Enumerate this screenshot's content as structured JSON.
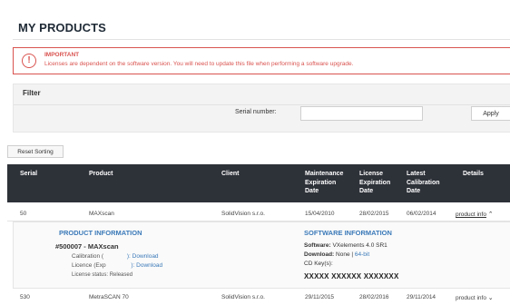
{
  "page": {
    "title": "MY PRODUCTS"
  },
  "alert": {
    "icon": "exclamation-icon",
    "title": "IMPORTANT",
    "text": "Licenses are dependent on the software version. You will need to update this file when performing a software upgrade."
  },
  "filter": {
    "title": "Filter",
    "serial_label": "Serial number:",
    "serial_value": "",
    "apply_label": "Apply"
  },
  "table": {
    "reset_label": "Reset Sorting",
    "headers": {
      "serial": "Serial",
      "product": "Product",
      "client": "Client",
      "maintenance": "Maintenance Expiration Date",
      "license": "License Expiration Date",
      "calibration": "Latest Calibration Date",
      "details": "Details"
    },
    "rows": [
      {
        "serial": "50",
        "product": "MAXscan",
        "client": "SolidVision s.r.o.",
        "maintenance": "15/04/2010",
        "license": "28/02/2015",
        "calibration": "06/02/2014",
        "details": "product info",
        "chevron": "chevron-up-icon"
      },
      {
        "serial": "530",
        "product": "MetraSCAN 70",
        "client": "SolidVision s.r.o.",
        "maintenance": "29/11/2015",
        "license": "28/02/2016",
        "calibration": "29/11/2014",
        "details": "product info",
        "chevron": "chevron-down-icon"
      }
    ]
  },
  "product_info": {
    "title": "PRODUCT INFORMATION",
    "name": "#500007 - MAXscan",
    "calibration_label": "Calibration (",
    "calibration_link": "): Download",
    "licence_label": "Licence (Exp",
    "licence_link": "): Download",
    "status": "License status: Released"
  },
  "software_info": {
    "title": "SOFTWARE INFORMATION",
    "software_label": "Software:",
    "software_value": "VXelements 4.0 SR1",
    "download_label": "Download:",
    "download_none": "None",
    "download_sep": "|",
    "download_link": "64-bit",
    "cd_keys_label": "CD Key(s):",
    "cd_keys_value": "XXXXX XXXXXX XXXXXXX"
  }
}
